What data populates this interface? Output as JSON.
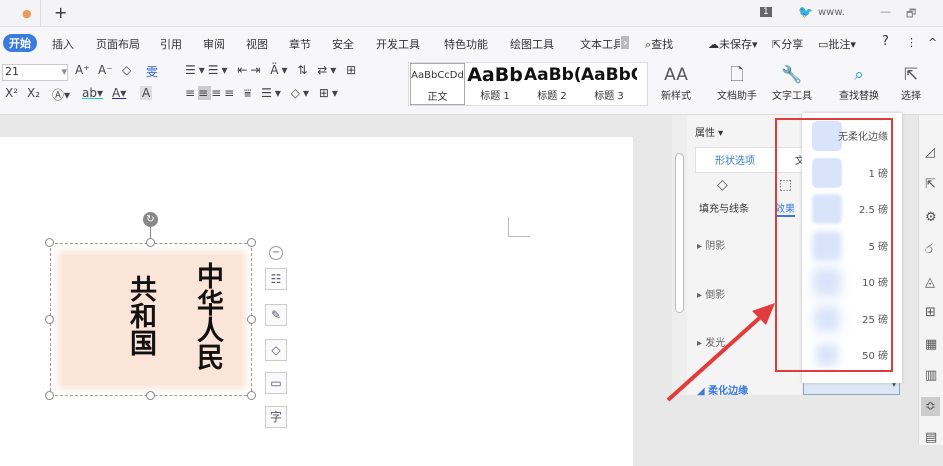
{
  "tabbar": {
    "new_tab": "+",
    "badge": "1",
    "user": "www.",
    "minimize": "—",
    "restore": "🗗"
  },
  "menu": [
    "开始",
    "插入",
    "页面布局",
    "引用",
    "审阅",
    "视图",
    "章节",
    "安全",
    "开发工具",
    "特色功能",
    "绘图工具",
    "文本工具"
  ],
  "menu_right": {
    "search": "查找",
    "unsaved": "未保存",
    "share": "分享",
    "comment": "批注",
    "help": "?",
    "more": "⋮",
    "collapse": "^"
  },
  "ribbon": {
    "font_size": "21",
    "grow": "A⁺",
    "shrink": "A⁻",
    "clear": "◇",
    "pinyin": "雯",
    "superscript": "X²",
    "subscript": "X₂",
    "styles": [
      {
        "preview": "AaBbCcDd",
        "name": "正文"
      },
      {
        "preview": "AaBb",
        "name": "标题 1"
      },
      {
        "preview": "AaBb(",
        "name": "标题 2"
      },
      {
        "preview": "AaBbC",
        "name": "标题 3"
      }
    ],
    "new_style": "新样式",
    "doc_helper": "文档助手",
    "text_tools": "文字工具",
    "find_replace": "查找替换",
    "select": "选择"
  },
  "textbox": {
    "col1": "中华人民",
    "col2": "共和国"
  },
  "panel": {
    "title": "属性",
    "tab_shape": "形状选项",
    "tab_text": "文",
    "fill_line": "填充与线条",
    "effects": "效果",
    "sections": [
      "阴影",
      "倒影",
      "发光",
      "柔化边缘"
    ]
  },
  "soft_edge_options": [
    {
      "label": "无柔化边缘",
      "blur": 0
    },
    {
      "label": "1 磅",
      "blur": 1
    },
    {
      "label": "2.5 磅",
      "blur": 2.5
    },
    {
      "label": "5 磅",
      "blur": 5
    },
    {
      "label": "10 磅",
      "blur": 10
    },
    {
      "label": "25 磅",
      "blur": 25
    },
    {
      "label": "50 磅",
      "blur": 50
    }
  ],
  "colors": {
    "accent": "#3a7be0",
    "highlight": "#e23b3b",
    "textbox_fill": "#fbe4d8"
  }
}
